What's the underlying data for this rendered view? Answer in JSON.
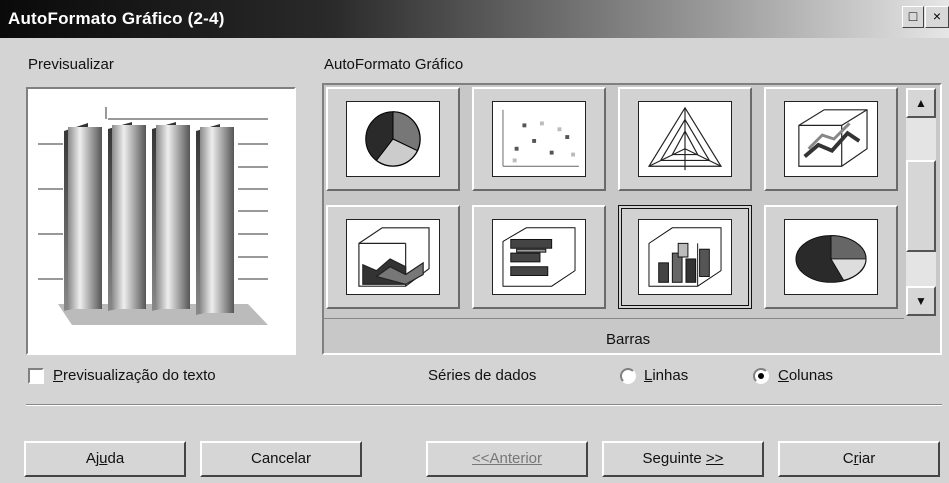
{
  "window": {
    "title": "AutoFormato Gráfico  (2-4)",
    "controls": {
      "maximize": "□",
      "close": "×"
    }
  },
  "preview": {
    "label": "Previsualizar"
  },
  "gallery": {
    "label": "AutoFormato Gráfico",
    "selected_caption": "Barras",
    "items": [
      {
        "name": "pie-chart-icon"
      },
      {
        "name": "scatter-chart-icon"
      },
      {
        "name": "net-chart-icon"
      },
      {
        "name": "3d-lines-chart-icon"
      },
      {
        "name": "3d-area-chart-icon"
      },
      {
        "name": "3d-bar-chart-icon"
      },
      {
        "name": "3d-columns-chart-icon",
        "selected": true
      },
      {
        "name": "3d-pie-chart-icon"
      }
    ]
  },
  "text_preview": {
    "label": "Previsualização do texto",
    "checked": false
  },
  "data_series": {
    "label": "Séries de dados",
    "options": [
      {
        "label": "Linhas",
        "selected": false
      },
      {
        "label": "Colunas",
        "selected": true
      }
    ]
  },
  "buttons": {
    "help": "Ajuda",
    "cancel": "Cancelar",
    "back": "<<Anterior",
    "next": "Seguinte >>",
    "create": "Criar"
  }
}
